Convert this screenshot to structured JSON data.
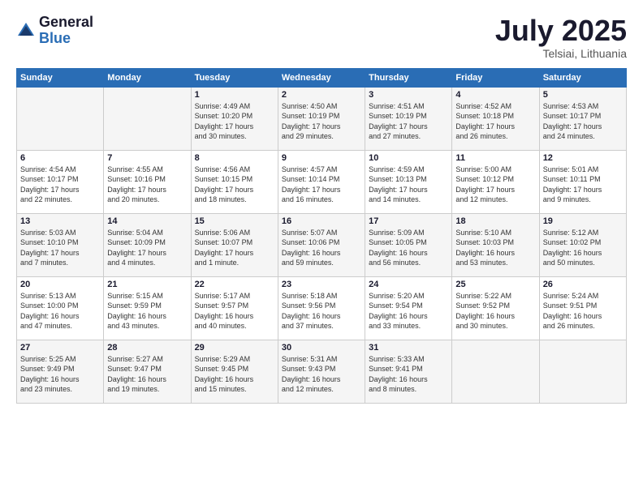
{
  "header": {
    "logo_general": "General",
    "logo_blue": "Blue",
    "month": "July 2025",
    "location": "Telsiai, Lithuania"
  },
  "weekdays": [
    "Sunday",
    "Monday",
    "Tuesday",
    "Wednesday",
    "Thursday",
    "Friday",
    "Saturday"
  ],
  "weeks": [
    [
      {
        "day": "",
        "content": ""
      },
      {
        "day": "",
        "content": ""
      },
      {
        "day": "1",
        "content": "Sunrise: 4:49 AM\nSunset: 10:20 PM\nDaylight: 17 hours\nand 30 minutes."
      },
      {
        "day": "2",
        "content": "Sunrise: 4:50 AM\nSunset: 10:19 PM\nDaylight: 17 hours\nand 29 minutes."
      },
      {
        "day": "3",
        "content": "Sunrise: 4:51 AM\nSunset: 10:19 PM\nDaylight: 17 hours\nand 27 minutes."
      },
      {
        "day": "4",
        "content": "Sunrise: 4:52 AM\nSunset: 10:18 PM\nDaylight: 17 hours\nand 26 minutes."
      },
      {
        "day": "5",
        "content": "Sunrise: 4:53 AM\nSunset: 10:17 PM\nDaylight: 17 hours\nand 24 minutes."
      }
    ],
    [
      {
        "day": "6",
        "content": "Sunrise: 4:54 AM\nSunset: 10:17 PM\nDaylight: 17 hours\nand 22 minutes."
      },
      {
        "day": "7",
        "content": "Sunrise: 4:55 AM\nSunset: 10:16 PM\nDaylight: 17 hours\nand 20 minutes."
      },
      {
        "day": "8",
        "content": "Sunrise: 4:56 AM\nSunset: 10:15 PM\nDaylight: 17 hours\nand 18 minutes."
      },
      {
        "day": "9",
        "content": "Sunrise: 4:57 AM\nSunset: 10:14 PM\nDaylight: 17 hours\nand 16 minutes."
      },
      {
        "day": "10",
        "content": "Sunrise: 4:59 AM\nSunset: 10:13 PM\nDaylight: 17 hours\nand 14 minutes."
      },
      {
        "day": "11",
        "content": "Sunrise: 5:00 AM\nSunset: 10:12 PM\nDaylight: 17 hours\nand 12 minutes."
      },
      {
        "day": "12",
        "content": "Sunrise: 5:01 AM\nSunset: 10:11 PM\nDaylight: 17 hours\nand 9 minutes."
      }
    ],
    [
      {
        "day": "13",
        "content": "Sunrise: 5:03 AM\nSunset: 10:10 PM\nDaylight: 17 hours\nand 7 minutes."
      },
      {
        "day": "14",
        "content": "Sunrise: 5:04 AM\nSunset: 10:09 PM\nDaylight: 17 hours\nand 4 minutes."
      },
      {
        "day": "15",
        "content": "Sunrise: 5:06 AM\nSunset: 10:07 PM\nDaylight: 17 hours\nand 1 minute."
      },
      {
        "day": "16",
        "content": "Sunrise: 5:07 AM\nSunset: 10:06 PM\nDaylight: 16 hours\nand 59 minutes."
      },
      {
        "day": "17",
        "content": "Sunrise: 5:09 AM\nSunset: 10:05 PM\nDaylight: 16 hours\nand 56 minutes."
      },
      {
        "day": "18",
        "content": "Sunrise: 5:10 AM\nSunset: 10:03 PM\nDaylight: 16 hours\nand 53 minutes."
      },
      {
        "day": "19",
        "content": "Sunrise: 5:12 AM\nSunset: 10:02 PM\nDaylight: 16 hours\nand 50 minutes."
      }
    ],
    [
      {
        "day": "20",
        "content": "Sunrise: 5:13 AM\nSunset: 10:00 PM\nDaylight: 16 hours\nand 47 minutes."
      },
      {
        "day": "21",
        "content": "Sunrise: 5:15 AM\nSunset: 9:59 PM\nDaylight: 16 hours\nand 43 minutes."
      },
      {
        "day": "22",
        "content": "Sunrise: 5:17 AM\nSunset: 9:57 PM\nDaylight: 16 hours\nand 40 minutes."
      },
      {
        "day": "23",
        "content": "Sunrise: 5:18 AM\nSunset: 9:56 PM\nDaylight: 16 hours\nand 37 minutes."
      },
      {
        "day": "24",
        "content": "Sunrise: 5:20 AM\nSunset: 9:54 PM\nDaylight: 16 hours\nand 33 minutes."
      },
      {
        "day": "25",
        "content": "Sunrise: 5:22 AM\nSunset: 9:52 PM\nDaylight: 16 hours\nand 30 minutes."
      },
      {
        "day": "26",
        "content": "Sunrise: 5:24 AM\nSunset: 9:51 PM\nDaylight: 16 hours\nand 26 minutes."
      }
    ],
    [
      {
        "day": "27",
        "content": "Sunrise: 5:25 AM\nSunset: 9:49 PM\nDaylight: 16 hours\nand 23 minutes."
      },
      {
        "day": "28",
        "content": "Sunrise: 5:27 AM\nSunset: 9:47 PM\nDaylight: 16 hours\nand 19 minutes."
      },
      {
        "day": "29",
        "content": "Sunrise: 5:29 AM\nSunset: 9:45 PM\nDaylight: 16 hours\nand 15 minutes."
      },
      {
        "day": "30",
        "content": "Sunrise: 5:31 AM\nSunset: 9:43 PM\nDaylight: 16 hours\nand 12 minutes."
      },
      {
        "day": "31",
        "content": "Sunrise: 5:33 AM\nSunset: 9:41 PM\nDaylight: 16 hours\nand 8 minutes."
      },
      {
        "day": "",
        "content": ""
      },
      {
        "day": "",
        "content": ""
      }
    ]
  ]
}
